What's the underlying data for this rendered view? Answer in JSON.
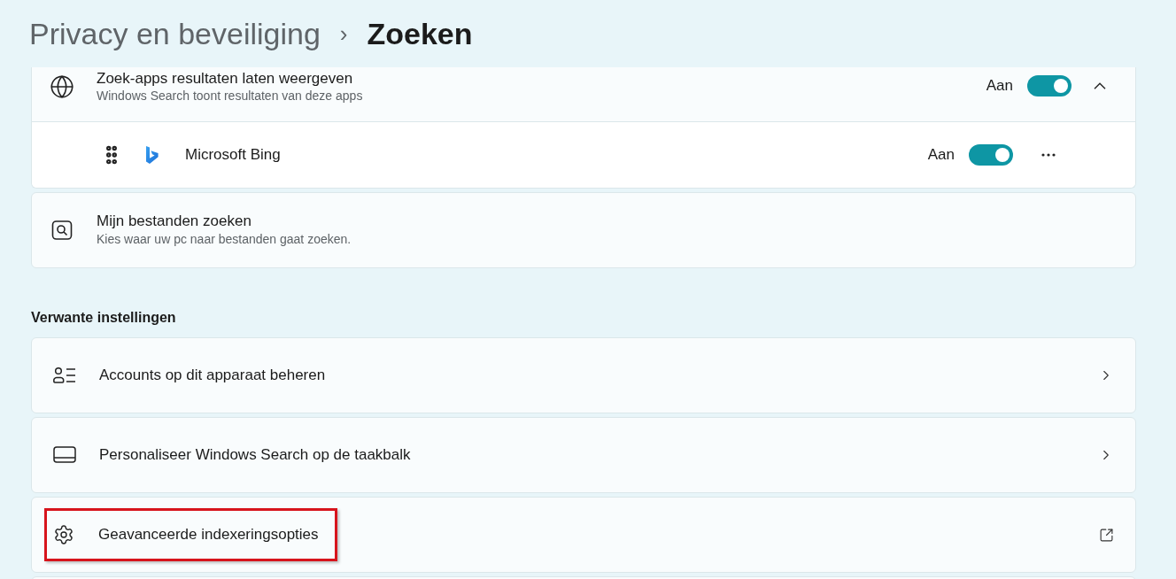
{
  "breadcrumb": {
    "parent": "Privacy en beveiliging",
    "separator": "›",
    "current": "Zoeken"
  },
  "search_apps": {
    "title": "Zoek-apps resultaten laten weergeven",
    "subtitle": "Windows Search toont resultaten van deze apps",
    "state_label": "Aan",
    "on": true,
    "expanded": true,
    "apps": [
      {
        "name": "Microsoft Bing",
        "state_label": "Aan",
        "on": true
      }
    ]
  },
  "my_files": {
    "title": "Mijn bestanden zoeken",
    "subtitle": "Kies waar uw pc naar bestanden gaat zoeken."
  },
  "related": {
    "heading": "Verwante instellingen",
    "items": [
      {
        "label": "Accounts op dit apparaat beheren",
        "kind": "chevron",
        "highlighted": false
      },
      {
        "label": "Personaliseer Windows Search op de taakbalk",
        "kind": "chevron",
        "highlighted": false
      },
      {
        "label": "Geavanceerde indexeringsopties",
        "kind": "external",
        "highlighted": true
      }
    ]
  }
}
